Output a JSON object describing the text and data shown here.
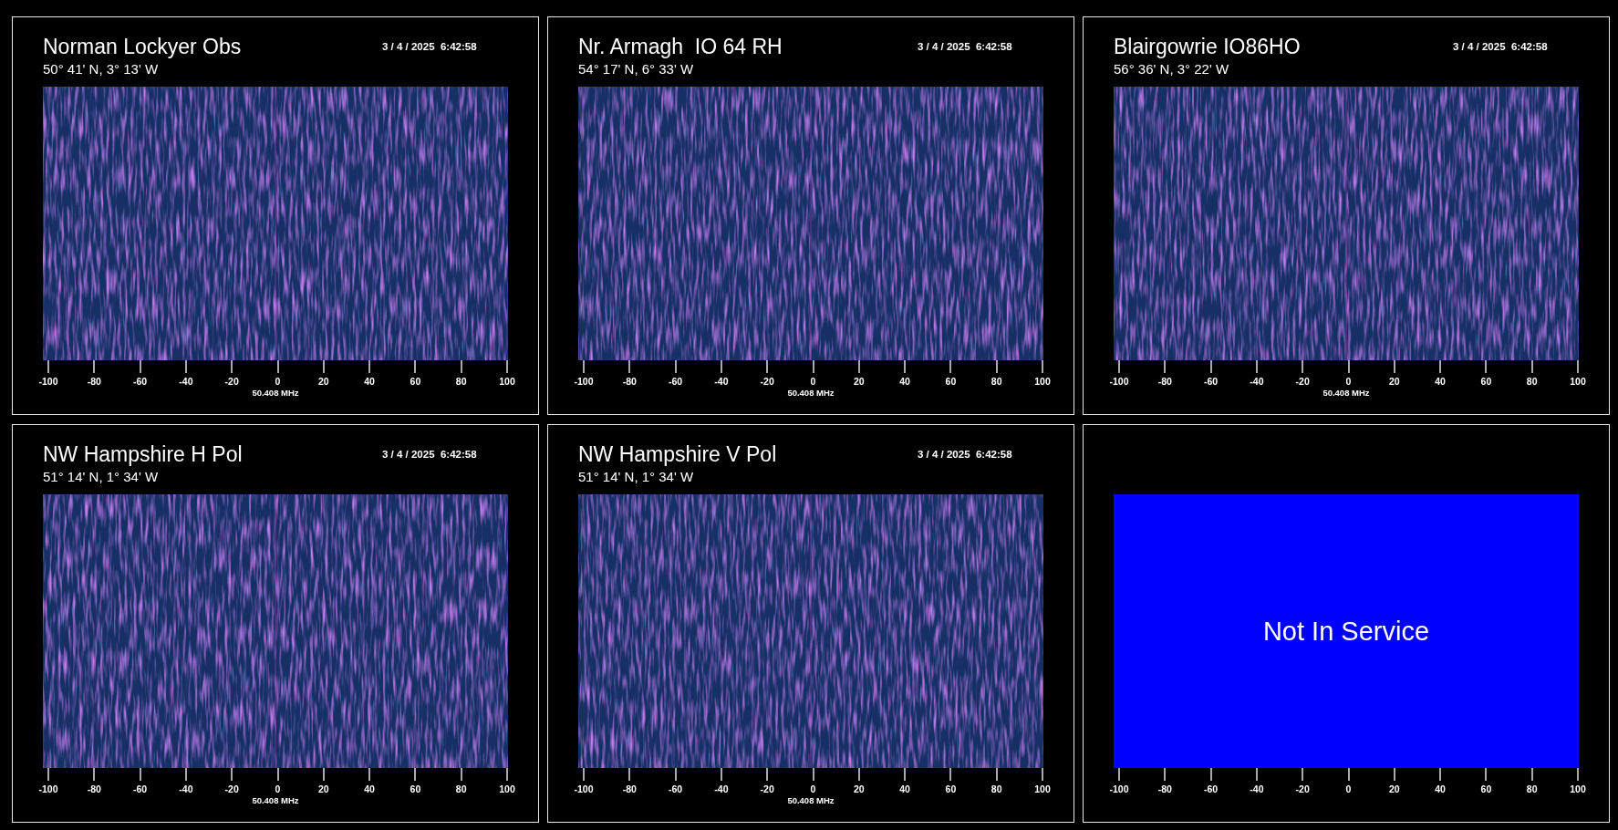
{
  "panels": [
    {
      "kind": "live",
      "title": "Norman Lockyer Obs",
      "timestamp": "3 / 4 / 2025  6:42:58",
      "location": "50° 41' N, 3° 13' W",
      "axis_ticks": [
        "-100",
        "-80",
        "-60",
        "-40",
        "-20",
        "0",
        "20",
        "40",
        "60",
        "80",
        "100"
      ],
      "axis_label": "50.408 MHz"
    },
    {
      "kind": "live",
      "title": "Nr. Armagh  IO 64 RH",
      "timestamp": "3 / 4 / 2025  6:42:58",
      "location": "54° 17' N, 6° 33' W",
      "axis_ticks": [
        "-100",
        "-80",
        "-60",
        "-40",
        "-20",
        "0",
        "20",
        "40",
        "60",
        "80",
        "100"
      ],
      "axis_label": "50.408 MHz"
    },
    {
      "kind": "live",
      "title": "Blairgowrie IO86HO",
      "timestamp": "3 / 4 / 2025  6:42:58",
      "location": "56° 36' N, 3° 22' W",
      "axis_ticks": [
        "-100",
        "-80",
        "-60",
        "-40",
        "-20",
        "0",
        "20",
        "40",
        "60",
        "80",
        "100"
      ],
      "axis_label": "50.408 MHz"
    },
    {
      "kind": "live",
      "title": "NW Hampshire H Pol",
      "timestamp": "3 / 4 / 2025  6:42:58",
      "location": "51° 14' N, 1° 34' W",
      "axis_ticks": [
        "-100",
        "-80",
        "-60",
        "-40",
        "-20",
        "0",
        "20",
        "40",
        "60",
        "80",
        "100"
      ],
      "axis_label": "50.408 MHz"
    },
    {
      "kind": "live",
      "title": "NW Hampshire V Pol",
      "timestamp": "3 / 4 / 2025  6:42:58",
      "location": "51° 14' N, 1° 34' W",
      "axis_ticks": [
        "-100",
        "-80",
        "-60",
        "-40",
        "-20",
        "0",
        "20",
        "40",
        "60",
        "80",
        "100"
      ],
      "axis_label": "50.408 MHz"
    },
    {
      "kind": "offline",
      "message": "Not In Service",
      "axis_ticks": [
        "-100",
        "-80",
        "-60",
        "-40",
        "-20",
        "0",
        "20",
        "40",
        "60",
        "80",
        "100"
      ]
    }
  ]
}
